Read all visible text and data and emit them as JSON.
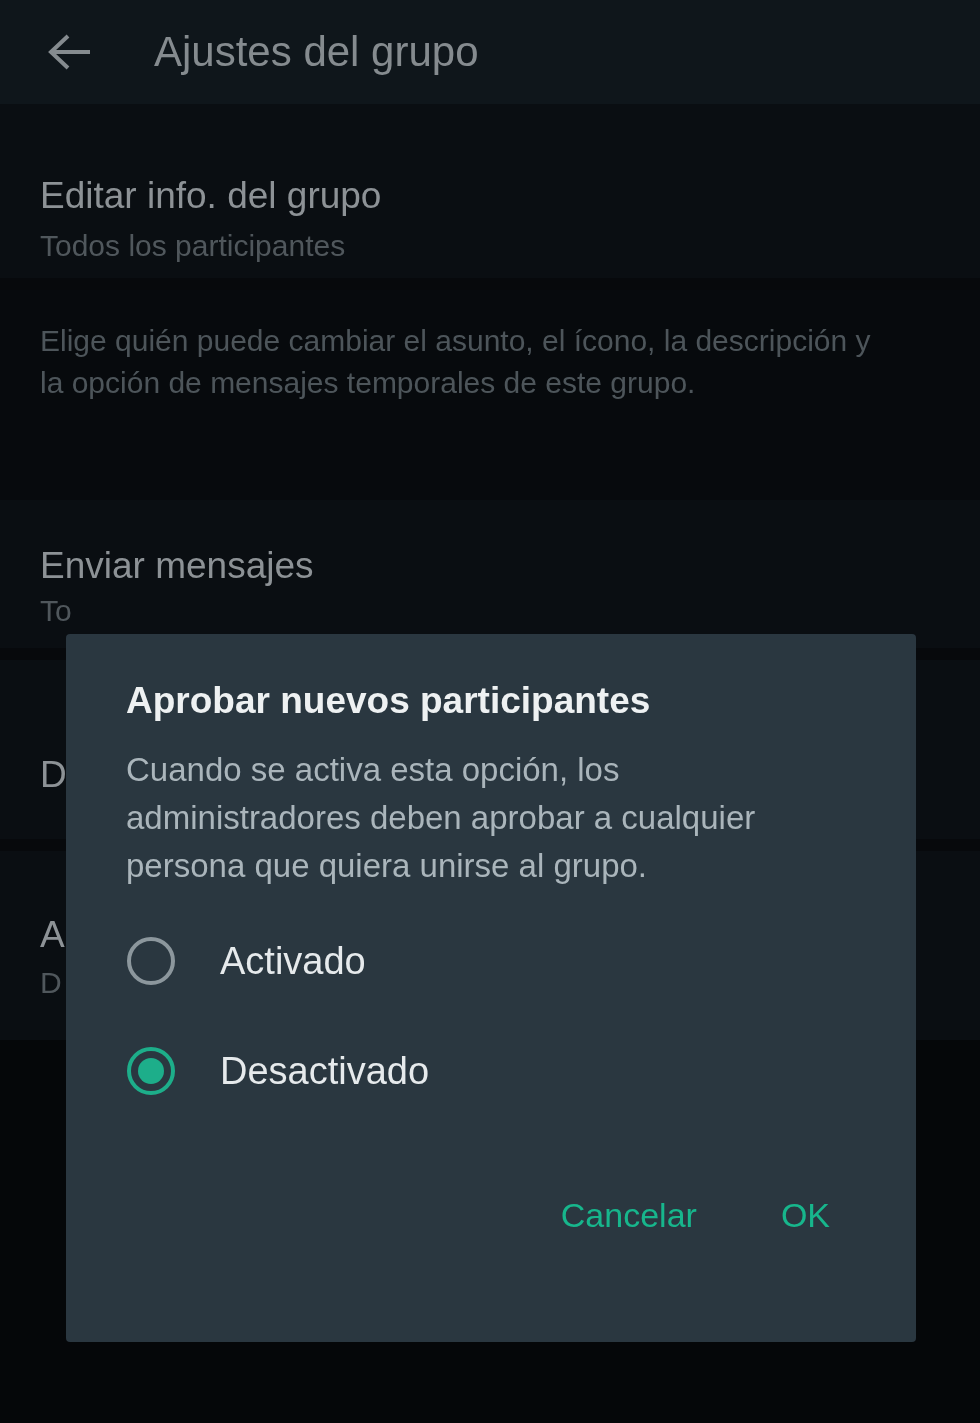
{
  "header": {
    "title": "Ajustes del grupo"
  },
  "settings": [
    {
      "title": "Editar info. del grupo",
      "subtitle": "Todos los participantes"
    },
    {
      "kind": "note",
      "text": "Elige quién puede cambiar el asunto, el ícono, la descripción y la opción de mensajes temporales de este grupo."
    },
    {
      "title": "Enviar mensajes",
      "subtitle": "To"
    },
    {
      "title": "D"
    },
    {
      "title": "A",
      "subtitle": "D"
    }
  ],
  "dialog": {
    "title": "Aprobar nuevos participantes",
    "message": "Cuando se activa esta opción, los administradores deben aprobar a cualquier persona que quiera unirse al grupo.",
    "options": [
      {
        "label": "Activado",
        "selected": false
      },
      {
        "label": "Desactivado",
        "selected": true
      }
    ],
    "buttons": [
      "Cancelar",
      "OK"
    ]
  }
}
